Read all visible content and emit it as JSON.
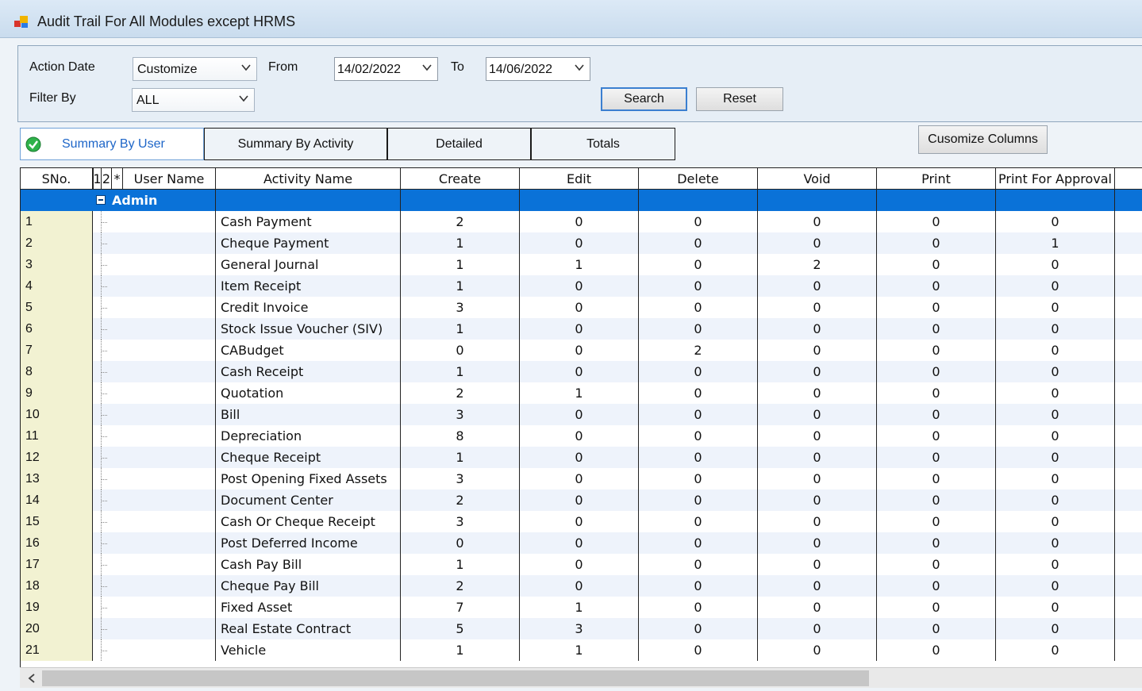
{
  "window": {
    "title": "Audit Trail For All Modules except HRMS"
  },
  "filters": {
    "action_date_label": "Action Date",
    "action_date_value": "Customize",
    "from_label": "From",
    "from_value": "14/02/2022",
    "to_label": "To",
    "to_value": "14/06/2022",
    "filter_by_label": "Filter By",
    "filter_by_value": "ALL",
    "search_label": "Search",
    "reset_label": "Reset"
  },
  "tabs": [
    {
      "label": "Summary By User",
      "active": true
    },
    {
      "label": "Summary By Activity"
    },
    {
      "label": "Detailed"
    },
    {
      "label": "Totals"
    }
  ],
  "customize_columns_label": "Cusomize Columns",
  "grid": {
    "columns": [
      "SNo.",
      "1",
      "2",
      "*",
      "User Name",
      "Activity Name",
      "Create",
      "Edit",
      "Delete",
      "Void",
      "Print",
      "Print For Approval"
    ],
    "group": "Admin",
    "rows": [
      [
        "1",
        "Cash Payment",
        "2",
        "0",
        "0",
        "0",
        "0",
        "0"
      ],
      [
        "2",
        "Cheque Payment",
        "1",
        "0",
        "0",
        "0",
        "0",
        "1"
      ],
      [
        "3",
        "General Journal",
        "1",
        "1",
        "0",
        "2",
        "0",
        "0"
      ],
      [
        "4",
        "Item Receipt",
        "1",
        "0",
        "0",
        "0",
        "0",
        "0"
      ],
      [
        "5",
        "Credit Invoice",
        "3",
        "0",
        "0",
        "0",
        "0",
        "0"
      ],
      [
        "6",
        "Stock Issue Voucher (SIV)",
        "1",
        "0",
        "0",
        "0",
        "0",
        "0"
      ],
      [
        "7",
        "CABudget",
        "0",
        "0",
        "2",
        "0",
        "0",
        "0"
      ],
      [
        "8",
        "Cash Receipt",
        "1",
        "0",
        "0",
        "0",
        "0",
        "0"
      ],
      [
        "9",
        "Quotation",
        "2",
        "1",
        "0",
        "0",
        "0",
        "0"
      ],
      [
        "10",
        "Bill",
        "3",
        "0",
        "0",
        "0",
        "0",
        "0"
      ],
      [
        "11",
        "Depreciation",
        "8",
        "0",
        "0",
        "0",
        "0",
        "0"
      ],
      [
        "12",
        "Cheque Receipt",
        "1",
        "0",
        "0",
        "0",
        "0",
        "0"
      ],
      [
        "13",
        "Post Opening Fixed Assets",
        "3",
        "0",
        "0",
        "0",
        "0",
        "0"
      ],
      [
        "14",
        "Document Center",
        "2",
        "0",
        "0",
        "0",
        "0",
        "0"
      ],
      [
        "15",
        "Cash Or Cheque Receipt",
        "3",
        "0",
        "0",
        "0",
        "0",
        "0"
      ],
      [
        "16",
        "Post Deferred Income",
        "0",
        "0",
        "0",
        "0",
        "0",
        "0"
      ],
      [
        "17",
        "Cash Pay Bill",
        "1",
        "0",
        "0",
        "0",
        "0",
        "0"
      ],
      [
        "18",
        "Cheque Pay Bill",
        "2",
        "0",
        "0",
        "0",
        "0",
        "0"
      ],
      [
        "19",
        "Fixed Asset",
        "7",
        "1",
        "0",
        "0",
        "0",
        "0"
      ],
      [
        "20",
        "Real Estate Contract",
        "5",
        "3",
        "0",
        "0",
        "0",
        "0"
      ],
      [
        "21",
        "Vehicle",
        "1",
        "1",
        "0",
        "0",
        "0",
        "0"
      ]
    ]
  },
  "colors": {
    "accent": "#0a72d8",
    "sno_bg": "#f2f2d2",
    "row_alt": "#eef3fb"
  }
}
